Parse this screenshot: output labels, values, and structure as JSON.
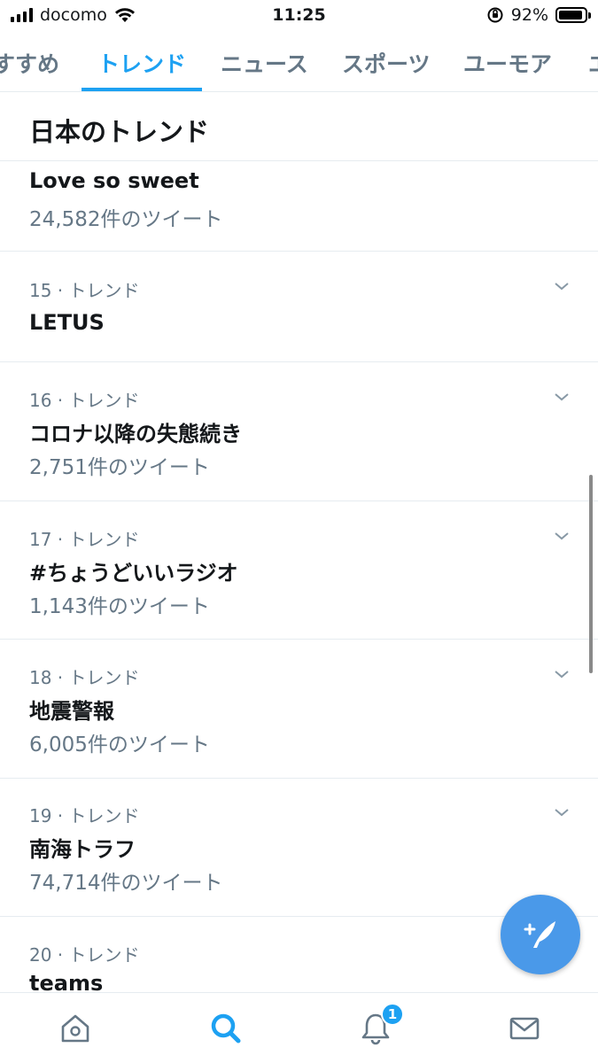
{
  "status_bar": {
    "carrier": "docomo",
    "time": "11:25",
    "battery": "92%",
    "battery_level": 0.92
  },
  "tabs": [
    {
      "label": "すすめ",
      "active": false
    },
    {
      "label": "トレンド",
      "active": true
    },
    {
      "label": "ニュース",
      "active": false
    },
    {
      "label": "スポーツ",
      "active": false
    },
    {
      "label": "ユーモア",
      "active": false
    },
    {
      "label": "エ",
      "active": false
    }
  ],
  "section": {
    "title": "日本のトレンド"
  },
  "trends": [
    {
      "meta": "",
      "name": "Love so sweet",
      "count": "24,582件のツイート"
    },
    {
      "meta": "15 · トレンド",
      "name": "LETUS",
      "count": ""
    },
    {
      "meta": "16 · トレンド",
      "name": "コロナ以降の失態続き",
      "count": "2,751件のツイート"
    },
    {
      "meta": "17 · トレンド",
      "name": "#ちょうどいいラジオ",
      "count": "1,143件のツイート"
    },
    {
      "meta": "18 · トレンド",
      "name": "地震警報",
      "count": "6,005件のツイート"
    },
    {
      "meta": "19 · トレンド",
      "name": "南海トラフ",
      "count": "74,714件のツイート"
    },
    {
      "meta": "20 · トレンド",
      "name": "teams",
      "count": ""
    }
  ],
  "nav": {
    "items": [
      "home-icon",
      "search-icon",
      "notifications-icon",
      "messages-icon"
    ],
    "notification_badge": "1"
  },
  "colors": {
    "accent": "#1da1f2",
    "secondary_text": "#657786",
    "divider": "#e6ecf0"
  }
}
